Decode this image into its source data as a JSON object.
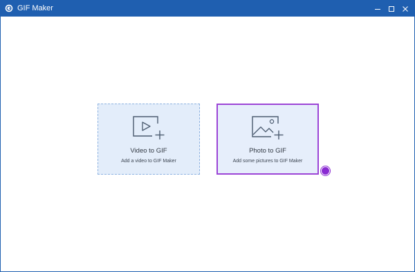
{
  "window": {
    "title": "GIF Maker",
    "titlebar_color": "#1f5fb0",
    "controls": {
      "minimize_icon": "minimize-icon",
      "maximize_icon": "maximize-icon",
      "close_icon": "close-icon"
    }
  },
  "cards": {
    "video": {
      "title": "Video to GIF",
      "subtitle": "Add a video to GIF Maker",
      "icon": "video-add-icon"
    },
    "photo": {
      "title": "Photo to GIF",
      "subtitle": "Add some pictures to GIF Maker",
      "icon": "photo-add-icon",
      "highlight_color": "#9b43d6"
    }
  }
}
